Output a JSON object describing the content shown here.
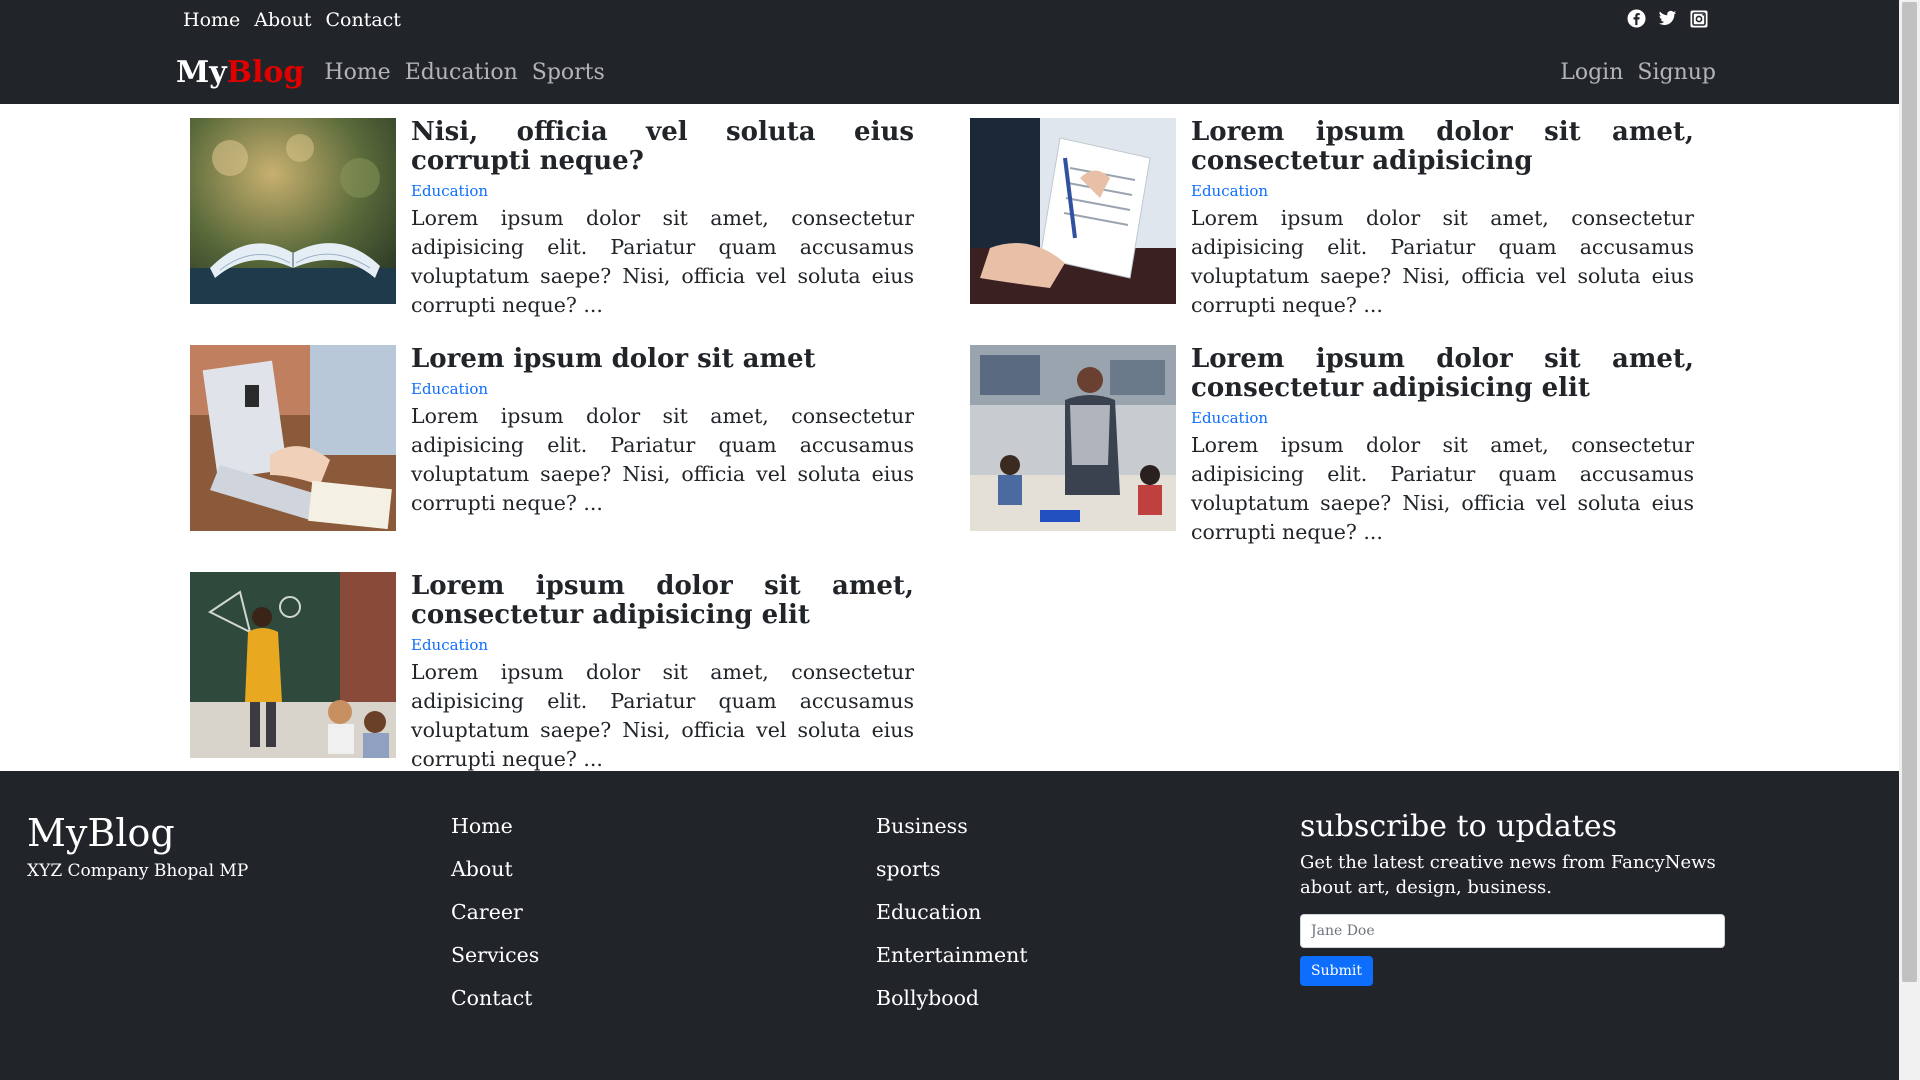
{
  "topbar": {
    "links": [
      "Home",
      "About",
      "Contact"
    ],
    "social_icons": [
      "facebook-icon",
      "twitter-icon",
      "instagram-icon"
    ]
  },
  "navbar": {
    "brand_part1": "My",
    "brand_part2": "Blog",
    "links": [
      "Home",
      "Education",
      "Sports"
    ],
    "auth": [
      "Login",
      "Signup"
    ]
  },
  "posts": [
    {
      "title": "Nisi, officia vel soluta eius corrupti neque?",
      "category": "Education",
      "excerpt": "Lorem ipsum dolor sit amet, consectetur adipisicing elit. Pariatur quam accusamus voluptatum saepe? Nisi, officia vel soluta eius corrupti neque? ..."
    },
    {
      "title": "Lorem ipsum dolor sit amet, consectetur adipisicing",
      "category": "Education",
      "excerpt": "Lorem ipsum dolor sit amet, consectetur adipisicing elit. Pariatur quam accusamus voluptatum saepe? Nisi, officia vel soluta eius corrupti neque? ..."
    },
    {
      "title": "Lorem ipsum dolor sit amet",
      "category": "Education",
      "excerpt": "Lorem ipsum dolor sit amet, consectetur adipisicing elit. Pariatur quam accusamus voluptatum saepe? Nisi, officia vel soluta eius corrupti neque? ..."
    },
    {
      "title": "Lorem ipsum dolor sit amet, consectetur adipisicing elit",
      "category": "Education",
      "excerpt": "Lorem ipsum dolor sit amet, consectetur adipisicing elit. Pariatur quam accusamus voluptatum saepe? Nisi, officia vel soluta eius corrupti neque? ..."
    },
    {
      "title": "Lorem ipsum dolor sit amet, consectetur adipisicing elit",
      "category": "Education",
      "excerpt": "Lorem ipsum dolor sit amet, consectetur adipisicing elit. Pariatur quam accusamus voluptatum saepe? Nisi, officia vel soluta eius corrupti neque? ..."
    }
  ],
  "footer": {
    "brand": "MyBlog",
    "address": "XYZ Company Bhopal MP",
    "col1": [
      "Home",
      "About",
      "Career",
      "Services",
      "Contact"
    ],
    "col2": [
      "Business",
      "sports",
      "Education",
      "Entertainment",
      "Bollybood"
    ],
    "subscribe": {
      "heading": "subscribe to updates",
      "text": "Get the latest creative news from FancyNews about art, design, business.",
      "placeholder": "Jane Doe",
      "button": "Submit"
    }
  },
  "colors": {
    "dark": "#212529",
    "brand_accent": "#e00000",
    "link_blue": "#0d6efd"
  }
}
